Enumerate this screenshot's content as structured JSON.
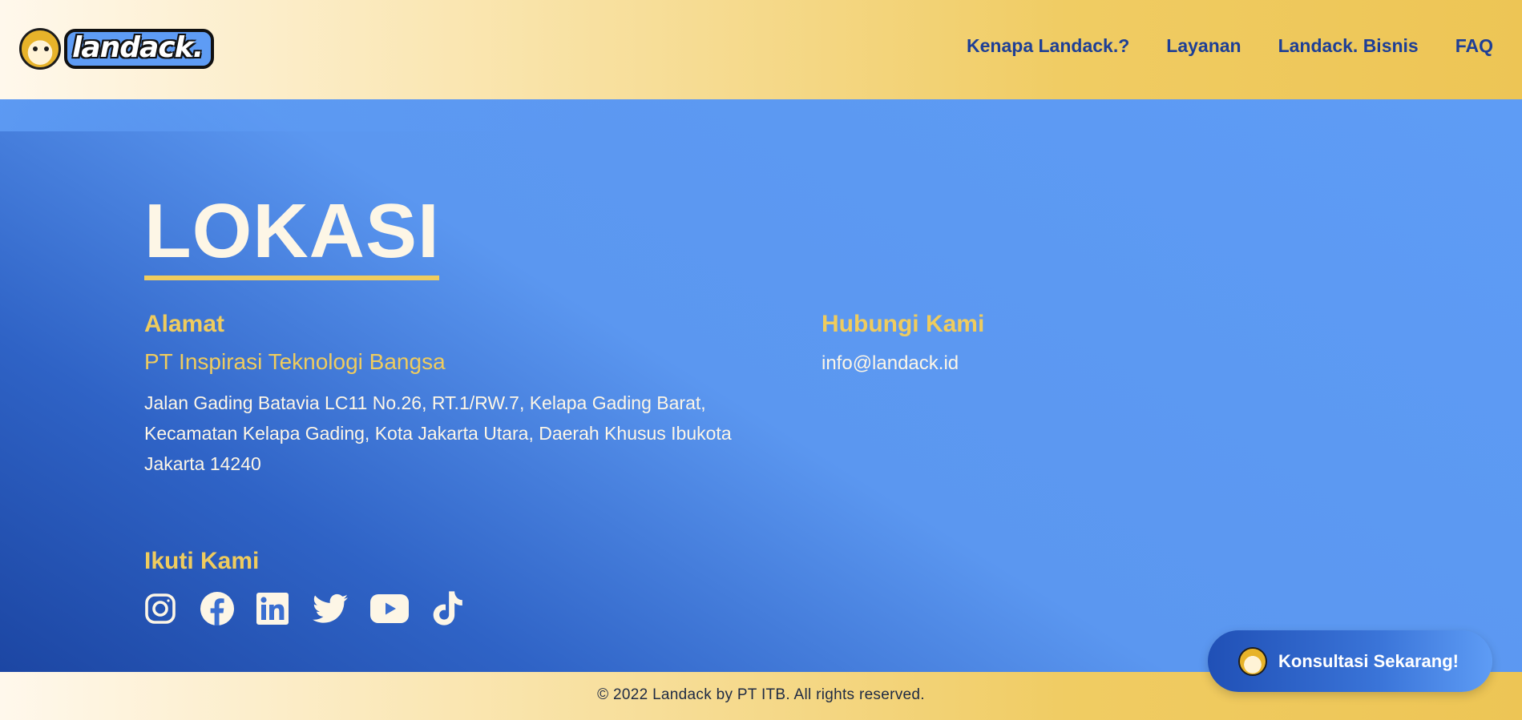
{
  "header": {
    "logo_text": "landack.",
    "nav": [
      {
        "label": "Kenapa Landack.?"
      },
      {
        "label": "Layanan"
      },
      {
        "label": "Landack. Bisnis"
      },
      {
        "label": "FAQ"
      }
    ]
  },
  "location": {
    "title": "LOKASI",
    "address_heading": "Alamat",
    "company": "PT Inspirasi Teknologi Bangsa",
    "address": "Jalan Gading Batavia LC11 No.26, RT.1/RW.7, Kelapa Gading Barat, Kecamatan Kelapa Gading, Kota Jakarta Utara, Daerah Khusus Ibukota Jakarta 14240",
    "contact_heading": "Hubungi Kami",
    "email": "info@landack.id",
    "follow_heading": "Ikuti Kami",
    "socials": [
      {
        "icon": "instagram-icon"
      },
      {
        "icon": "facebook-icon"
      },
      {
        "icon": "linkedin-icon"
      },
      {
        "icon": "twitter-icon"
      },
      {
        "icon": "youtube-icon"
      },
      {
        "icon": "tiktok-icon"
      }
    ]
  },
  "cta": {
    "label": "Konsultasi Sekarang!"
  },
  "footer": {
    "copyright": "© 2022 Landack by PT ITB. All rights reserved."
  },
  "colors": {
    "accent_yellow": "#efcc5e",
    "primary_blue": "#5e9cf5",
    "deep_blue": "#1c46a3",
    "nav_text": "#1e3f96",
    "cream_text": "#fdf6e6"
  }
}
